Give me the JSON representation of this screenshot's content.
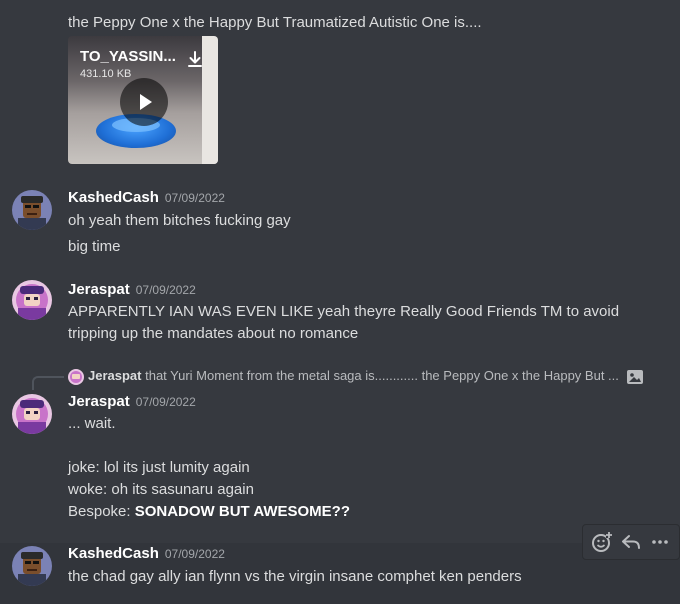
{
  "messages": {
    "m0": {
      "text": "the Peppy One x the Happy But Traumatized Autistic One is....",
      "attachment": {
        "file_name": "TO_YASSIN...",
        "file_size": "431.10 KB"
      }
    },
    "m1": {
      "username": "KashedCash",
      "timestamp": "07/09/2022",
      "lines": [
        "oh yeah them bitches fucking gay",
        "big time"
      ]
    },
    "m2": {
      "username": "Jeraspat",
      "timestamp": "07/09/2022",
      "lines": [
        "APPARENTLY IAN WAS EVEN LIKE yeah theyre Really Good Friends TM to avoid",
        "tripping up the mandates about no romance"
      ]
    },
    "m3": {
      "reply": {
        "username": "Jeraspat",
        "text": "that Yuri Moment from the metal saga is............  the Peppy One x the Happy But ..."
      },
      "username": "Jeraspat",
      "timestamp": "07/09/2022",
      "lines": [
        "... wait.",
        "joke: lol its just lumity again",
        "woke: oh its sasunaru again",
        "Bespoke: "
      ],
      "bold": "SONADOW BUT AWESOME??"
    },
    "m4": {
      "username": "KashedCash",
      "timestamp": "07/09/2022",
      "lines": [
        "the chad gay ally ian flynn vs the virgin insane comphet ken penders"
      ]
    }
  },
  "toolbar": {
    "icons": [
      "add-reaction-icon",
      "reply-icon",
      "more-icon"
    ]
  },
  "colors": {
    "background": "#36393f",
    "username": "#ffffff",
    "timestamp": "#a3a6aa",
    "text": "#dcddde"
  }
}
